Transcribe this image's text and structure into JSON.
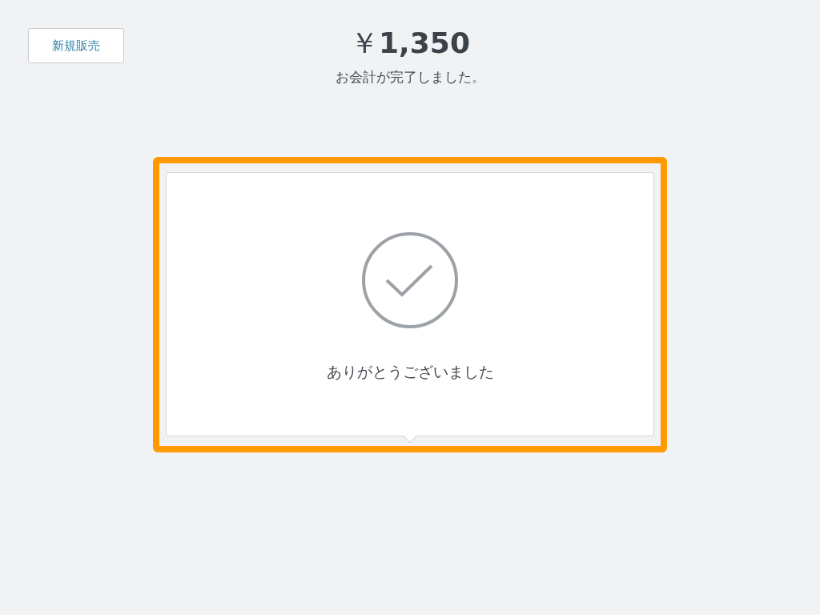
{
  "new_sale_button": {
    "label": "新規販売"
  },
  "total": "￥**1,350**",
  "status_message": "お会計が完了しました。",
  "thank_you_card": {
    "message": "ありがとうございました",
    "highlighted": true
  }
}
